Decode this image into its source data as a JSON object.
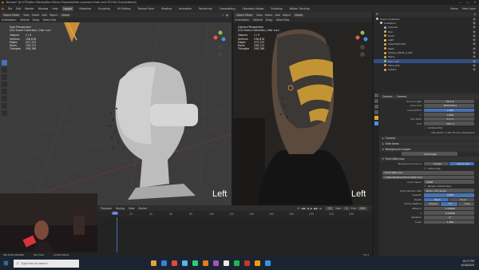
{
  "window": {
    "title": "Blender* [D:\\YTR\\After Effects\\After Effects Projects\\Delta summons finals.ver4 ZF\\Ollie Finishedblend]",
    "controls": [
      "—",
      "□",
      "✕"
    ]
  },
  "menu": {
    "items": [
      "File",
      "Edit",
      "Render",
      "Window",
      "Help"
    ],
    "workspaces": [
      "Layout",
      "Modeling",
      "Sculpting",
      "UV Editing",
      "Texture Paint",
      "Shading",
      "Animation",
      "Rendering",
      "Compositing",
      "Geometry Nodes",
      "Scripting",
      "Motion Tracking"
    ],
    "active_workspace": "Layout",
    "scene": "Scene",
    "view_layer": "View Layer"
  },
  "viewport_left": {
    "mode": "Object Mode",
    "menus": [
      "View",
      "Select",
      "Add",
      "Object"
    ],
    "transform": "Global",
    "orientation_label": "Orientation:",
    "orientation": "Default",
    "drag_label": "Drag:",
    "drag": "Select Box",
    "info_title": "User Perspective",
    "info_collection": "(23) Scene Collection | Hair curv",
    "stats": [
      {
        "k": "Objects",
        "v": "1 / 9"
      },
      {
        "k": "Vertices",
        "v": "128,816"
      },
      {
        "k": "Edges",
        "v": "257,723"
      },
      {
        "k": "Faces",
        "v": "128,712"
      },
      {
        "k": "Triangles",
        "v": "256,788"
      }
    ],
    "view_label": "Left"
  },
  "viewport_right": {
    "mode": "Object Mode",
    "menus": [
      "View",
      "Select",
      "Add",
      "Object"
    ],
    "transform": "Global",
    "orientation_label": "Orientation:",
    "orientation": "Default",
    "drag_label": "Drag:",
    "drag": "Select Box",
    "info_title": "Camera Perspective",
    "info_collection": "(23) Scene Collection | Hair curv",
    "stats": [
      {
        "k": "Objects",
        "v": "1 / 9"
      },
      {
        "k": "Vertices",
        "v": "236,816"
      },
      {
        "k": "Edges",
        "v": "373,723"
      },
      {
        "k": "Faces",
        "v": "236,712"
      },
      {
        "k": "Triangles",
        "v": "256,788"
      }
    ],
    "view_label": "Left"
  },
  "outliner": {
    "title": "Scene Collection",
    "rows": [
      {
        "label": "Scene Collection",
        "color": "#cccccc",
        "indent": 0,
        "selected": false
      },
      {
        "label": "Collection",
        "color": "#cccccc",
        "indent": 1,
        "selected": false
      },
      {
        "label": "Camera",
        "color": "#8fb8e8",
        "indent": 2,
        "selected": false
      },
      {
        "label": "Hair",
        "color": "#e8a55a",
        "indent": 2,
        "selected": false
      },
      {
        "label": "Head",
        "color": "#e8a55a",
        "indent": 2,
        "selected": false
      },
      {
        "label": "Light",
        "color": "#e8d85a",
        "indent": 2,
        "selected": false
      },
      {
        "label": "basemesh.003",
        "color": "#e8a55a",
        "indent": 2,
        "selected": false
      },
      {
        "label": "Mask",
        "color": "#e8a55a",
        "indent": 2,
        "selected": false
      },
      {
        "label": "Sphere_MASK_II.002",
        "color": "#e8a55a",
        "indent": 2,
        "selected": false
      },
      {
        "label": "Plane",
        "color": "#e8a55a",
        "indent": 2,
        "selected": false
      },
      {
        "label": "Hair curv",
        "color": "#7ec97e",
        "indent": 2,
        "selected": true
      },
      {
        "label": "Plane.001",
        "color": "#e8a55a",
        "indent": 2,
        "selected": false
      },
      {
        "label": "Sphere",
        "color": "#e8a55a",
        "indent": 2,
        "selected": false
      }
    ]
  },
  "properties": {
    "object": "Camera",
    "data": "Camera",
    "fields": [
      {
        "label": "Focal Length",
        "value": "52.4 m",
        "blue": false
      },
      {
        "label": "Lens Unit",
        "value": "Millimeters",
        "blue": false
      },
      {
        "label": "Lens Shift X",
        "value": "0.000",
        "blue": true
      },
      {
        "label": "Y",
        "value": "0.000",
        "blue": false
      },
      {
        "label": "Clip Start",
        "value": "0.1 m",
        "blue": false
      },
      {
        "label": "End",
        "value": "100 m",
        "blue": false
      }
    ],
    "composition_check": "Composition",
    "clip_note": "Clip Factor: 1.00, 52 mm equivalent",
    "sections": [
      "Camera",
      "Safe Areas",
      "Background Images"
    ],
    "add_image": "Add Image",
    "bg_item": "Front.Web.mov",
    "bg_tabs": [
      "Image",
      "Movie Clip"
    ],
    "bg_active_tab": "Movie Clip",
    "bg_row_label": "Background Source",
    "active_clip": "Active Clip",
    "movie_clip_label": "Front.Web.mov",
    "clip_file": "1.[Render]Front/Front.Web.mov",
    "color_space_label": "Color Space",
    "color_space": "sRGB",
    "render_undistorted": "Render Undistorted",
    "proxy_label": "Proxy Render Size",
    "proxy": "None, full render",
    "opacity_label": "Opacity",
    "opacity": "0.800",
    "depth_label": "Depth",
    "depth_back": "Back",
    "depth_front": "Front",
    "frame_label": "Frame Method",
    "frame_stretch": "Stretch",
    "frame_fit": "Fit",
    "frame_crop": "Crop",
    "offset_label": "Offset X",
    "offset_x": "0.00000",
    "offset_y": "0.00000",
    "rotation_label": "Rotation",
    "rotation": "0°",
    "scale_label": "Scale",
    "scale": "1.000"
  },
  "timeline": {
    "menus": [
      "Playback",
      "Keying",
      "View",
      "Marker"
    ],
    "current_frame": "23",
    "start_label": "Start",
    "start": "1",
    "end_label": "End",
    "end": "250",
    "ticks": [
      "20",
      "40",
      "60",
      "80",
      "100",
      "120",
      "140",
      "160",
      "180",
      "200",
      "220",
      "240"
    ]
  },
  "statusbar": {
    "items": [
      "Set Active Modifier",
      "Pan View",
      "Context Menu"
    ],
    "version": "3.3.1"
  },
  "taskbar": {
    "search": "Type here to search",
    "time": "10:27 PM",
    "date": "6/18/2023",
    "app_colors": [
      "#e3a53b",
      "#3b7fd4",
      "#e04a3a",
      "#5fb0e8",
      "#2ecc71",
      "#ea7a1a",
      "#9b59b6",
      "#e8e8e8",
      "#1db954",
      "#c0392b",
      "#f39c12",
      "#3498db"
    ]
  }
}
